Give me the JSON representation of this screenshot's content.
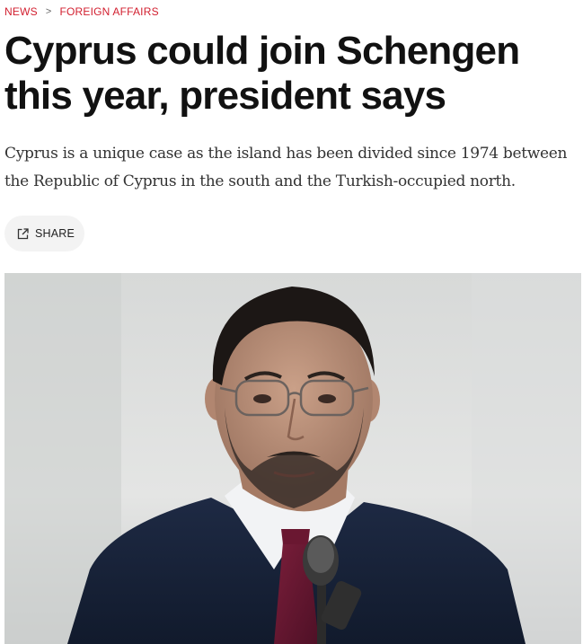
{
  "breadcrumb": {
    "items": [
      "NEWS",
      "FOREIGN AFFAIRS"
    ],
    "separator": ">"
  },
  "article": {
    "headline": "Cyprus could join Schengen this year, president says",
    "dek": "Cyprus is a unique case as the island has been divided since 1974 between the Republic of Cyprus in the south and the Turkish-occupied north.",
    "share_label": "SHARE"
  },
  "icons": {
    "share": "share-external-icon"
  },
  "colors": {
    "accent": "#d21f2f",
    "share_bg": "#f3f3f3",
    "headline": "#111111",
    "dek": "#333333"
  }
}
